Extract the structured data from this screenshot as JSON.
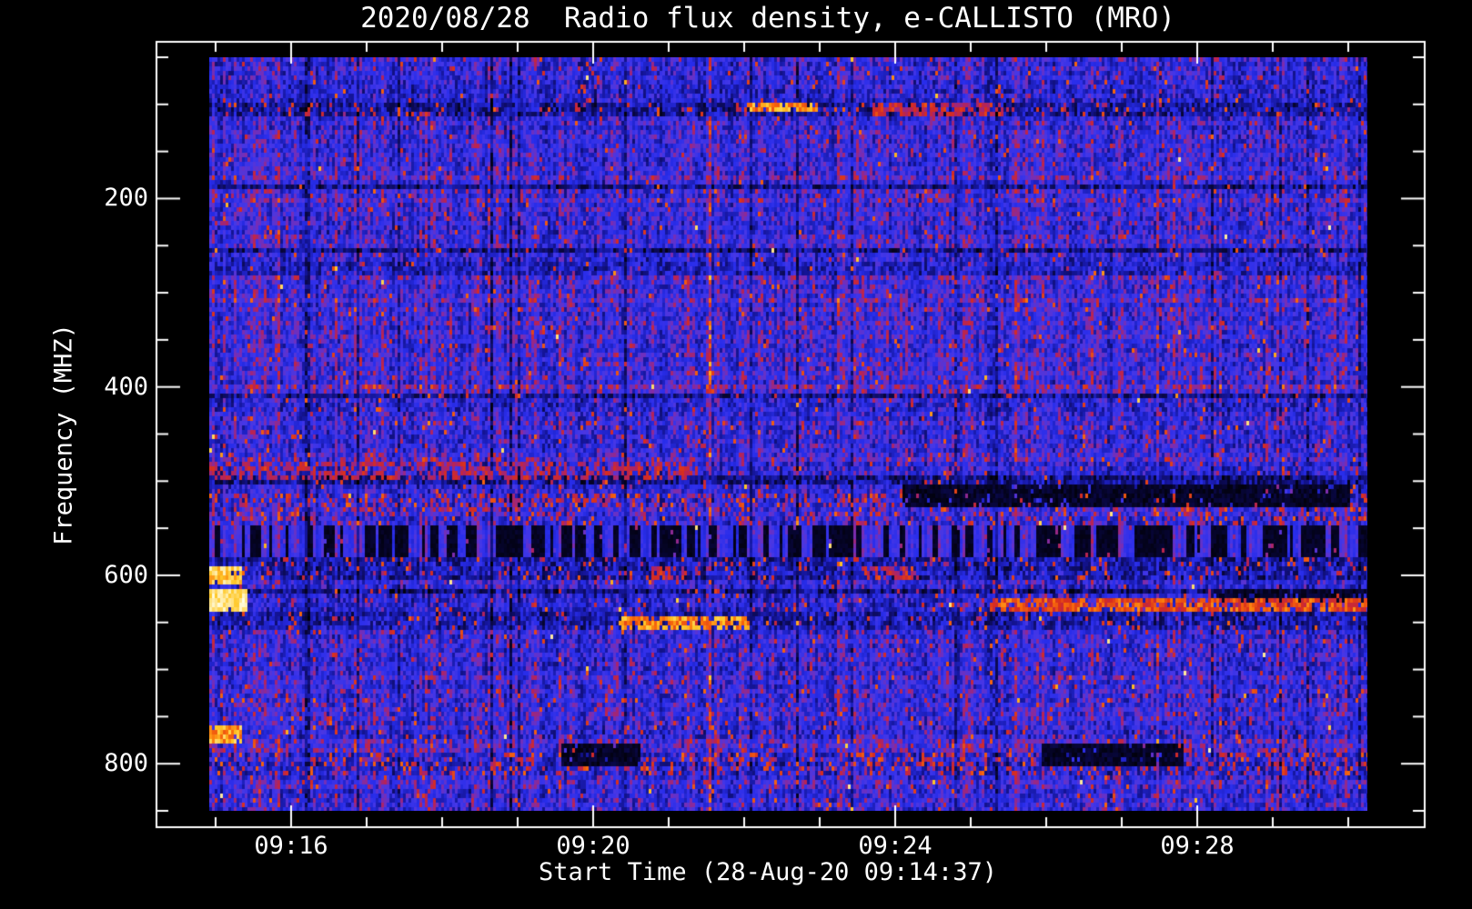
{
  "chart_data": {
    "type": "heatmap",
    "title": "2020/08/28  Radio flux density, e-CALLISTO (MRO)",
    "xlabel": "Start Time (28-Aug-20 09:14:37)",
    "ylabel": "Frequency (MHZ)",
    "x_tick_labels": [
      "09:16",
      "09:20",
      "09:24",
      "09:28"
    ],
    "y_tick_labels": [
      "200",
      "400",
      "600",
      "800"
    ],
    "x_axis": {
      "start_time": "09:14:37",
      "end_time": "~09:30",
      "minor_tick_minutes": 1,
      "major_tick_minutes": 4,
      "first_tick_label": "09:16"
    },
    "y_axis": {
      "unit": "MHZ",
      "min": 50,
      "max": 850,
      "minor_tick_step": 50,
      "major_tick_step": 200,
      "direction": "increasing downward"
    },
    "style": {
      "background": "#000000",
      "frame_color": "#ffffff",
      "text_color": "#ffffff",
      "colormap": "blue background noise with red/orange/yellow RFI bands"
    },
    "bands": [
      {
        "f0": 50,
        "f1": 81,
        "base": 0.43,
        "red": 0.03
      },
      {
        "f0": 81,
        "f1": 97,
        "base": 0.38,
        "red": 0.03
      },
      {
        "f0": 97,
        "f1": 113,
        "base": 0.26,
        "red": 0.1
      },
      {
        "f0": 113,
        "f1": 188,
        "base": 0.44,
        "red": 0.02
      },
      {
        "f0": 188,
        "f1": 200,
        "base": 0.42,
        "red": 0.06
      },
      {
        "f0": 200,
        "f1": 240,
        "base": 0.44,
        "red": 0.03
      },
      {
        "f0": 240,
        "f1": 252,
        "base": 0.48,
        "red": 0.02
      },
      {
        "f0": 252,
        "f1": 268,
        "base": 0.42,
        "red": 0.03
      },
      {
        "f0": 268,
        "f1": 283,
        "base": 0.34,
        "red": 0.02
      },
      {
        "f0": 283,
        "f1": 412,
        "base": 0.47,
        "red": 0.03
      },
      {
        "f0": 412,
        "f1": 428,
        "base": 0.4,
        "red": 0.05
      },
      {
        "f0": 428,
        "f1": 481,
        "base": 0.45,
        "red": 0.04
      },
      {
        "f0": 481,
        "f1": 496,
        "base": 0.4,
        "red": 0.06
      },
      {
        "f0": 496,
        "f1": 513,
        "base": 0.42,
        "red": 0.04
      },
      {
        "f0": 513,
        "f1": 526,
        "base": 0.42,
        "red": 0.3
      },
      {
        "f0": 526,
        "f1": 549,
        "base": 0.45,
        "red": 0.14
      },
      {
        "f0": 549,
        "f1": 579,
        "picket": true
      },
      {
        "f0": 579,
        "f1": 603,
        "base": 0.28,
        "red": 0.08
      },
      {
        "f0": 603,
        "f1": 616,
        "base": 0.42,
        "red": 0.03
      },
      {
        "f0": 616,
        "f1": 638,
        "base": 0.4,
        "red": 0.05
      },
      {
        "f0": 638,
        "f1": 660,
        "base": 0.3,
        "red": 0.06
      },
      {
        "f0": 660,
        "f1": 722,
        "base": 0.44,
        "red": 0.03
      },
      {
        "f0": 722,
        "f1": 762,
        "base": 0.46,
        "red": 0.06
      },
      {
        "f0": 762,
        "f1": 776,
        "base": 0.4,
        "red": 0.08
      },
      {
        "f0": 776,
        "f1": 790,
        "base": 0.5,
        "red": 0.04
      },
      {
        "f0": 790,
        "f1": 814,
        "base": 0.36,
        "red": 0.22
      },
      {
        "f0": 814,
        "f1": 850,
        "base": 0.44,
        "red": 0.04
      }
    ],
    "features": [
      {
        "type": "orange_streak",
        "x0": 0.465,
        "x1": 0.525,
        "f0": 100,
        "f1": 107
      },
      {
        "type": "red_patch",
        "x0": 0.575,
        "x1": 0.685,
        "f0": 99,
        "f1": 108
      },
      {
        "type": "red_streaks",
        "x0": 0.0,
        "x1": 0.42,
        "f0": 481,
        "f1": 495
      },
      {
        "type": "dark",
        "x0": 0.6,
        "x1": 0.985,
        "f0": 508,
        "f1": 527
      },
      {
        "type": "yellow_blob",
        "x0": 0.0,
        "x1": 0.028,
        "f0": 594,
        "f1": 607
      },
      {
        "type": "red_patch",
        "x0": 0.38,
        "x1": 0.41,
        "f0": 591,
        "f1": 601
      },
      {
        "type": "red_patch",
        "x0": 0.565,
        "x1": 0.61,
        "f0": 591,
        "f1": 601
      },
      {
        "type": "bright_yellow_blob",
        "x0": 0.0,
        "x1": 0.032,
        "f0": 616,
        "f1": 636
      },
      {
        "type": "dark",
        "x0": 0.87,
        "x1": 1.0,
        "f0": 615,
        "f1": 627
      },
      {
        "type": "orange_red_streak",
        "x0": 0.675,
        "x1": 1.0,
        "f0": 626,
        "f1": 637
      },
      {
        "type": "orange_streak",
        "x0": 0.355,
        "x1": 0.465,
        "f0": 647,
        "f1": 657
      },
      {
        "type": "orange_blob",
        "x0": 0.0,
        "x1": 0.028,
        "f0": 762,
        "f1": 776
      },
      {
        "type": "dark",
        "x0": 0.305,
        "x1": 0.37,
        "f0": 781,
        "f1": 800
      },
      {
        "type": "dark",
        "x0": 0.72,
        "x1": 0.84,
        "f0": 781,
        "f1": 800
      }
    ]
  }
}
